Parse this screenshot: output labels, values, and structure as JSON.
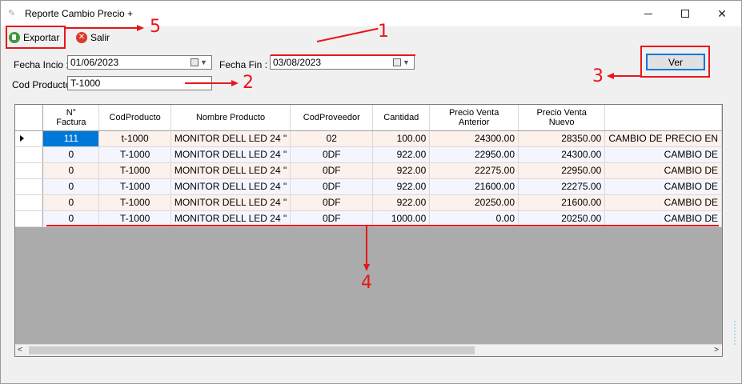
{
  "window": {
    "title": "Reporte Cambio Precio +",
    "minimize_glyph": "—",
    "maximize_glyph": "☐",
    "close_glyph": "✕"
  },
  "toolbar": {
    "export_label": "Exportar",
    "exit_label": "Salir"
  },
  "filters": {
    "start_label": "Fecha Incio :",
    "start_value": "01/06/2023",
    "end_label": "Fecha Fin :",
    "end_value": "03/08/2023",
    "product_label": "Cod Producto:",
    "product_value": "T-1000",
    "view_button": "Ver"
  },
  "grid": {
    "columns": [
      "N°\nFactura",
      "CodProducto",
      "Nombre Producto",
      "CodProveedor",
      "Cantidad",
      "Precio Venta\nAnterior",
      "Precio Venta\nNuevo",
      ""
    ],
    "rows": [
      [
        "111",
        "t-1000",
        "MONITOR DELL LED 24 \"",
        "02",
        "100.00",
        "24300.00",
        "28350.00",
        "CAMBIO DE PRECIO EN"
      ],
      [
        "0",
        "T-1000",
        "MONITOR DELL LED 24 \"",
        "0DF",
        "922.00",
        "22950.00",
        "24300.00",
        "CAMBIO DE"
      ],
      [
        "0",
        "T-1000",
        "MONITOR DELL LED 24 \"",
        "0DF",
        "922.00",
        "22275.00",
        "22950.00",
        "CAMBIO DE"
      ],
      [
        "0",
        "T-1000",
        "MONITOR DELL LED 24 \"",
        "0DF",
        "922.00",
        "21600.00",
        "22275.00",
        "CAMBIO DE"
      ],
      [
        "0",
        "T-1000",
        "MONITOR DELL LED 24 \"",
        "0DF",
        "922.00",
        "20250.00",
        "21600.00",
        "CAMBIO DE"
      ],
      [
        "0",
        "T-1000",
        "MONITOR DELL LED 24 \"",
        "0DF",
        "1000.00",
        "0.00",
        "20250.00",
        "CAMBIO DE"
      ]
    ]
  },
  "scrollbar": {
    "left_glyph": "<",
    "right_glyph": ">"
  },
  "annotations": {
    "n1": "1",
    "n2": "2",
    "n3": "3",
    "n4": "4",
    "n5": "5"
  },
  "colors": {
    "annotation": "#e8161b",
    "selection": "#0078d7",
    "grid_background": "#ababab"
  }
}
